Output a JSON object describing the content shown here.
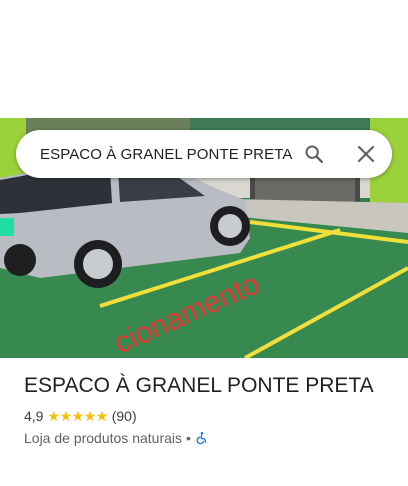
{
  "search": {
    "query": "ESPACO À GRANEL PONTE PRETA",
    "search_icon": "search-icon",
    "close_icon": "close-icon"
  },
  "photo": {
    "overlay_text": "cionamento"
  },
  "place": {
    "title": "ESPACO À GRANEL PONTE PRETA",
    "rating": "4,9",
    "stars": "★★★★★",
    "review_count": "(90)",
    "category": "Loja de produtos naturais",
    "separator": "•",
    "accessibility_icon": "wheelchair-icon"
  },
  "colors": {
    "star": "#fbbc04",
    "accent": "#1a73e8",
    "overlay_text": "#e53935"
  }
}
